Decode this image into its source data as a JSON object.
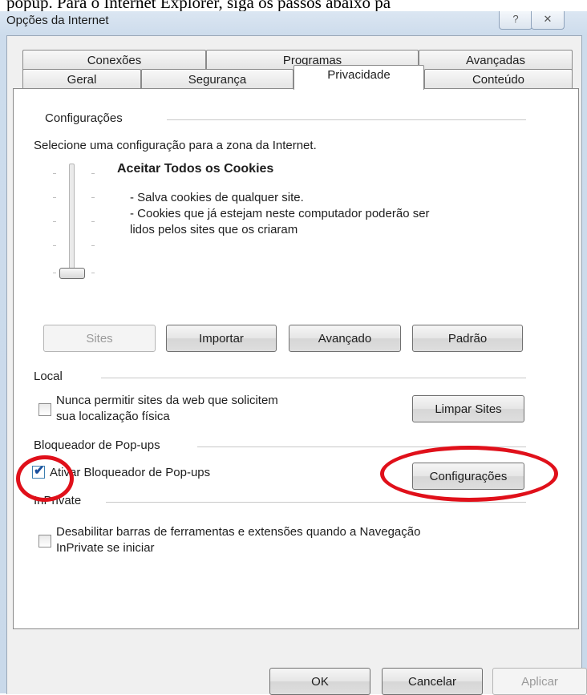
{
  "document_caption": "popup. Para o Internet Explorer, siga os passos abaixo pa",
  "window": {
    "title": "Opções da Internet",
    "help_glyph": "?",
    "close_glyph": "✕"
  },
  "tabs": {
    "row_back": [
      "Conexões",
      "Programas",
      "Avançadas"
    ],
    "row_front": [
      "Geral",
      "Segurança",
      "Privacidade",
      "Conteúdo"
    ],
    "active": "Privacidade"
  },
  "settings": {
    "group_title": "Configurações",
    "instruction": "Selecione uma configuração para a zona da Internet.",
    "level_title": "Aceitar Todos os Cookies",
    "level_desc": [
      "- Salva cookies de qualquer site.",
      "- Cookies que já estejam neste computador poderão ser",
      "lidos pelos sites que os criaram"
    ],
    "slider_level": 0,
    "buttons": [
      "Sites",
      "Importar",
      "Avançado",
      "Padrão"
    ]
  },
  "location": {
    "group_title": "Local",
    "checkbox_label_line1": "Nunca permitir sites da web que solicitem",
    "checkbox_label_line2": "sua localização física",
    "checked": false,
    "clear_button": "Limpar Sites"
  },
  "popup_blocker": {
    "group_title": "Bloqueador de Pop-ups",
    "checkbox_label": "Ativar Bloqueador de Pop-ups",
    "checked": true,
    "settings_button": "Configurações"
  },
  "inprivate": {
    "group_title": "InPrivate",
    "checkbox_label_line1": "Desabilitar barras de ferramentas e extensões quando a Navegação",
    "checkbox_label_line2": "InPrivate se iniciar",
    "checked": false
  },
  "footer": {
    "ok": "OK",
    "cancel": "Cancelar",
    "apply": "Aplicar"
  },
  "annotation_color": "#e0101a"
}
